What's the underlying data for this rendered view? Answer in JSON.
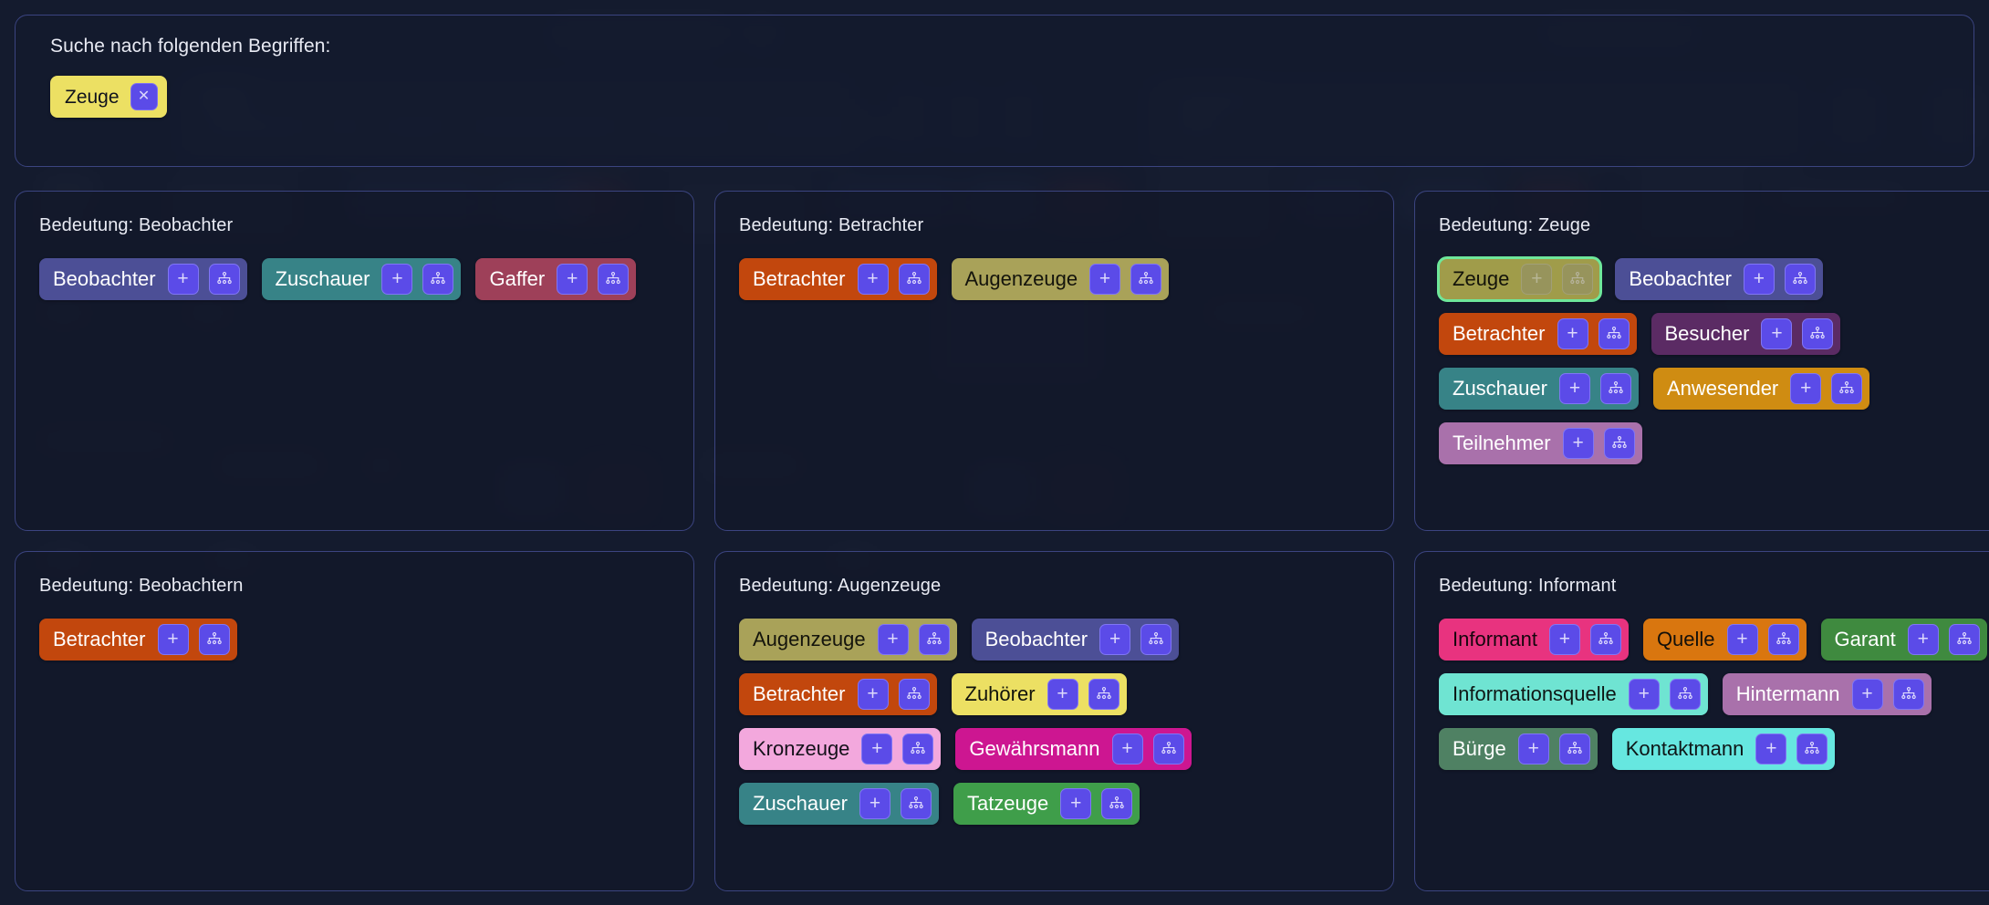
{
  "search": {
    "label": "Suche nach folgenden Begriffen:",
    "chips": [
      {
        "text": "Zeuge",
        "remove_icon": "close-icon",
        "color": "#ece063",
        "text_color": "#10121c"
      }
    ]
  },
  "tag_buttons": {
    "add_icon": "plus-icon",
    "add_label": "+",
    "hierarchy_icon": "hierarchy-icon"
  },
  "accent": {
    "button": "#5b4be8",
    "button_border": "#8076f5",
    "selection": "#6ee79a",
    "panel_border": "#3b4480",
    "page_background": "#141b2e"
  },
  "cards": [
    {
      "title": "Bedeutung: Beobachter",
      "rows": [
        [
          {
            "label": "Beobachter",
            "color": "#4c4f96",
            "text_color": "#ffffff",
            "selected": false
          },
          {
            "label": "Zuschauer",
            "color": "#378387",
            "text_color": "#ffffff",
            "selected": false
          },
          {
            "label": "Gaffer",
            "color": "#9e4059",
            "text_color": "#ffffff",
            "selected": false
          }
        ]
      ]
    },
    {
      "title": "Bedeutung: Betrachter",
      "rows": [
        [
          {
            "label": "Betrachter",
            "color": "#c2470d",
            "text_color": "#ffffff",
            "selected": false
          },
          {
            "label": "Augenzeuge",
            "color": "#a9a259",
            "text_color": "#14140c",
            "selected": false
          }
        ]
      ]
    },
    {
      "title": "Bedeutung: Zeuge",
      "rows": [
        [
          {
            "label": "Zeuge",
            "color": "#a09c4a",
            "text_color": "#13130a",
            "selected": true
          },
          {
            "label": "Beobachter",
            "color": "#4c4f96",
            "text_color": "#ffffff",
            "selected": false
          }
        ],
        [
          {
            "label": "Betrachter",
            "color": "#c2470d",
            "text_color": "#ffffff",
            "selected": false
          },
          {
            "label": "Besucher",
            "color": "#5b2b64",
            "text_color": "#ffffff",
            "selected": false
          }
        ],
        [
          {
            "label": "Zuschauer",
            "color": "#378387",
            "text_color": "#ffffff",
            "selected": false
          },
          {
            "label": "Anwesender",
            "color": "#cf8c12",
            "text_color": "#ffffff",
            "selected": false
          }
        ],
        [
          {
            "label": "Teilnehmer",
            "color": "#a971ab",
            "text_color": "#ffffff",
            "selected": false
          }
        ]
      ]
    },
    {
      "title": "Bedeutung: Beobachtern",
      "rows": [
        [
          {
            "label": "Betrachter",
            "color": "#c2470d",
            "text_color": "#ffffff",
            "selected": false
          }
        ]
      ]
    },
    {
      "title": "Bedeutung: Augenzeuge",
      "rows": [
        [
          {
            "label": "Augenzeuge",
            "color": "#a9a259",
            "text_color": "#14140c",
            "selected": false
          },
          {
            "label": "Beobachter",
            "color": "#4c4f96",
            "text_color": "#ffffff",
            "selected": false
          }
        ],
        [
          {
            "label": "Betrachter",
            "color": "#c2470d",
            "text_color": "#ffffff",
            "selected": false
          },
          {
            "label": "Zuhörer",
            "color": "#ece063",
            "text_color": "#11130c",
            "selected": false
          }
        ],
        [
          {
            "label": "Kronzeuge",
            "color": "#f3a8dd",
            "text_color": "#14111a",
            "selected": false
          },
          {
            "label": "Gewährsmann",
            "color": "#cd1691",
            "text_color": "#ffffff",
            "selected": false
          }
        ],
        [
          {
            "label": "Zuschauer",
            "color": "#378387",
            "text_color": "#ffffff",
            "selected": false
          },
          {
            "label": "Tatzeuge",
            "color": "#3f9e4a",
            "text_color": "#ffffff",
            "selected": false
          }
        ]
      ]
    },
    {
      "title": "Bedeutung: Informant",
      "rows": [
        [
          {
            "label": "Informant",
            "color": "#e8337f",
            "text_color": "#15060d",
            "selected": false
          },
          {
            "label": "Quelle",
            "color": "#d9760f",
            "text_color": "#14100a",
            "selected": false
          },
          {
            "label": "Garant",
            "color": "#3f8a3f",
            "text_color": "#ffffff",
            "selected": false
          }
        ],
        [
          {
            "label": "Informationsquelle",
            "color": "#6fe4d2",
            "text_color": "#0e1614",
            "selected": false
          },
          {
            "label": "Hintermann",
            "color": "#a971ab",
            "text_color": "#ffffff",
            "selected": false
          }
        ],
        [
          {
            "label": "Bürge",
            "color": "#4f8163",
            "text_color": "#ffffff",
            "selected": false
          },
          {
            "label": "Kontaktmann",
            "color": "#66e7e0",
            "text_color": "#0e1617",
            "selected": false
          }
        ]
      ]
    }
  ]
}
